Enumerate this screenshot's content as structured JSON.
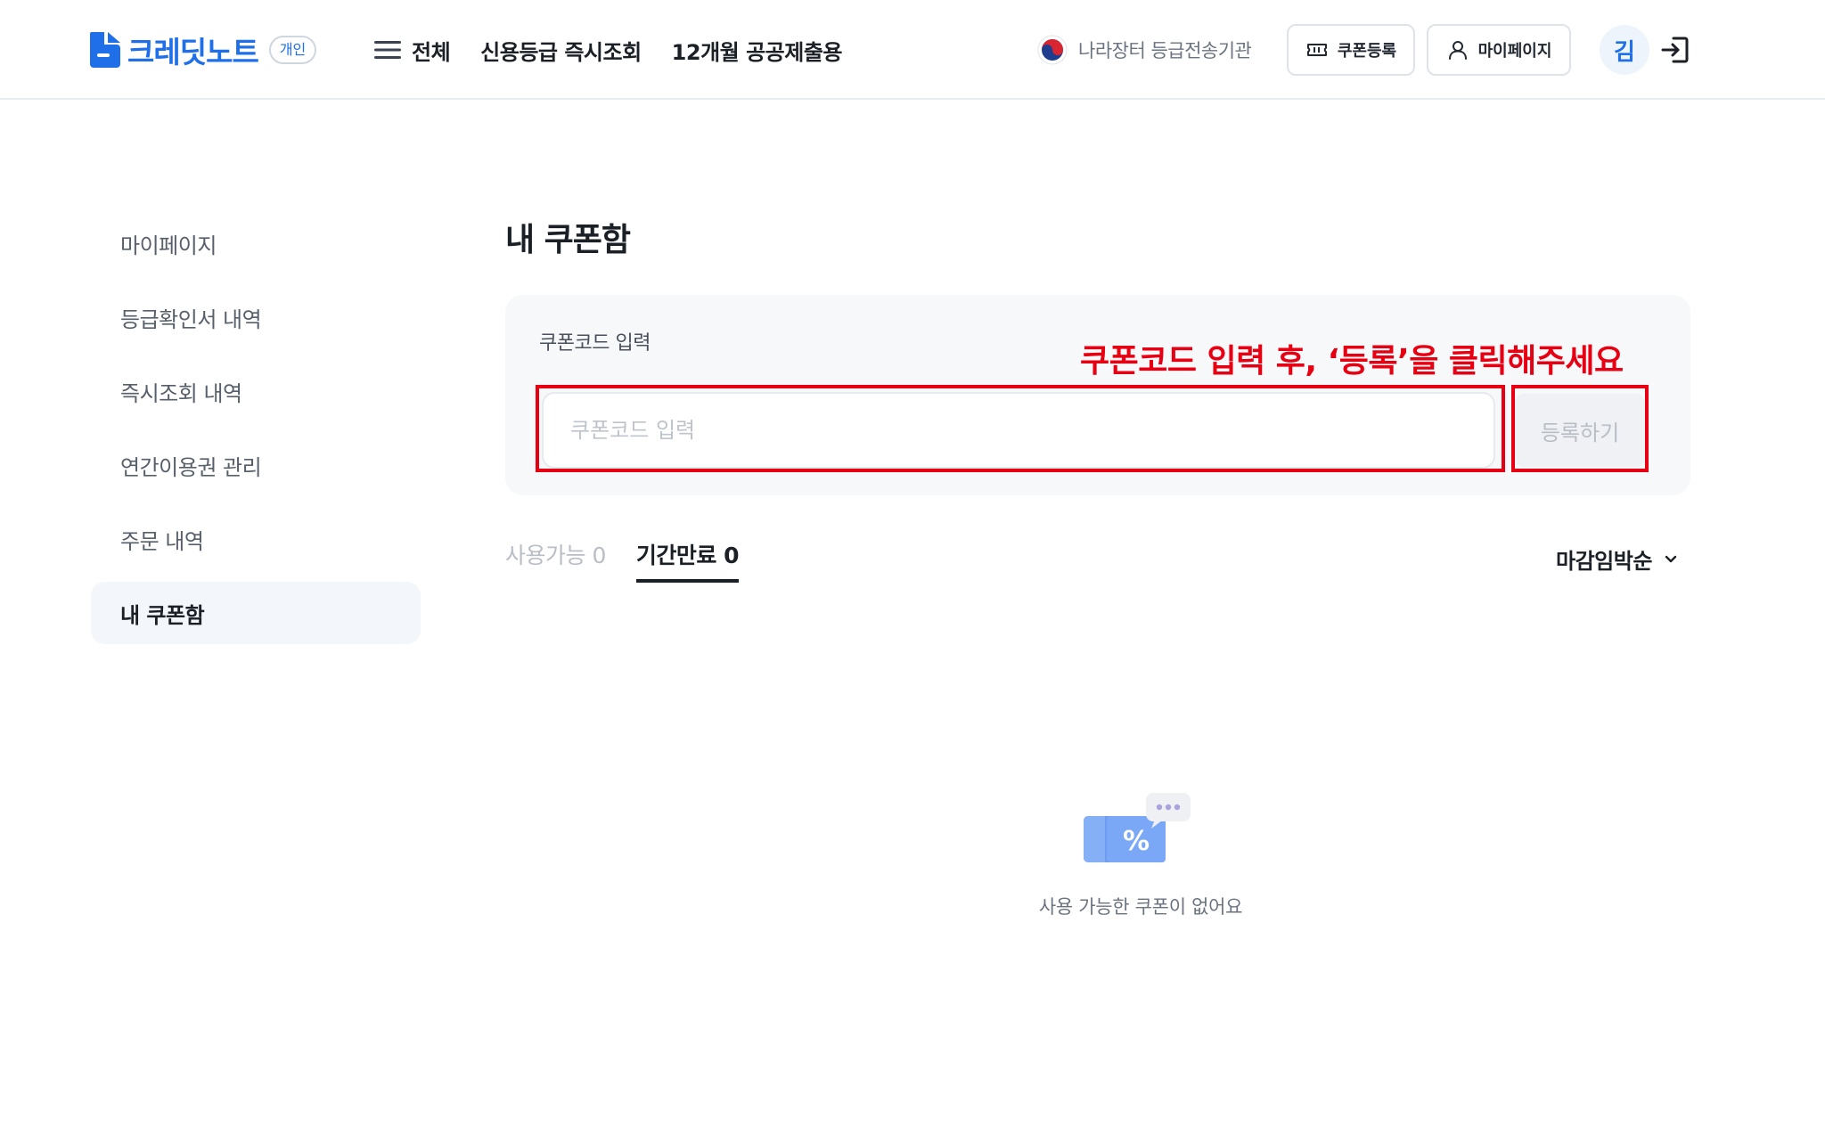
{
  "header": {
    "logo_text": "크레딧노트",
    "logo_badge": "개인",
    "menu_label": "전체",
    "nav": [
      {
        "label": "신용등급 즉시조회"
      },
      {
        "label": "12개월 공공제출용"
      }
    ],
    "agency_text": "나라장터 등급전송기관",
    "coupon_button": "쿠폰등록",
    "mypage_button": "마이페이지",
    "avatar_initial": "김"
  },
  "sidebar": {
    "items": [
      {
        "label": "마이페이지"
      },
      {
        "label": "등급확인서 내역"
      },
      {
        "label": "즉시조회 내역"
      },
      {
        "label": "연간이용권 관리"
      },
      {
        "label": "주문 내역"
      },
      {
        "label": "내 쿠폰함"
      }
    ],
    "active_index": 5
  },
  "main": {
    "title": "내 쿠폰함",
    "coupon_form": {
      "label": "쿠폰코드 입력",
      "input_placeholder": "쿠폰코드 입력",
      "input_value": "",
      "register_button": "등록하기",
      "annotation": "쿠폰코드 입력 후, ‘등록’을 클릭해주세요"
    },
    "tabs": [
      {
        "label": "사용가능 0",
        "active": false
      },
      {
        "label": "기간만료 0",
        "active": true
      }
    ],
    "sort": {
      "selected": "마감임박순"
    },
    "empty_message": "사용 가능한 쿠폰이 없어요"
  },
  "colors": {
    "brand_blue": "#1f6fe8",
    "annotation_red": "#e60012",
    "text_dark": "#1b1f26",
    "text_muted": "#6b7380"
  },
  "icons": {
    "logo": "document-logo-icon",
    "menu": "hamburger-icon",
    "agency": "taegeuk-emblem-icon",
    "coupon": "ticket-icon",
    "mypage": "user-icon",
    "logout": "logout-icon",
    "sort": "chevron-down-icon",
    "empty": "coupon-percent-illustration"
  }
}
